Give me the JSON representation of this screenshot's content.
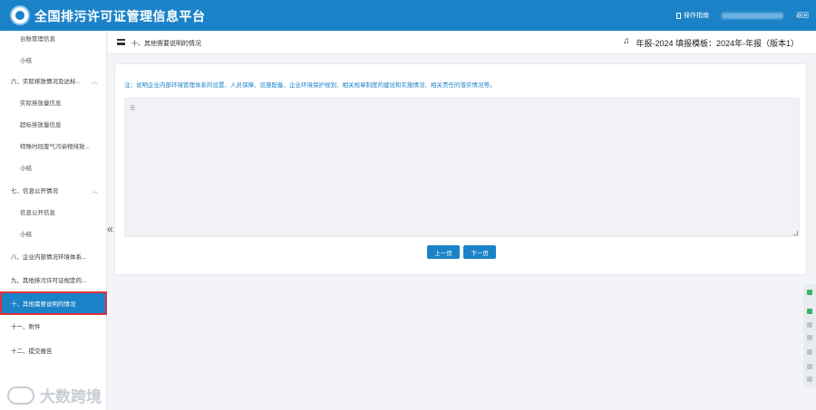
{
  "header": {
    "app_title": "全国排污许可证管理信息平台",
    "guide_label": "操作指南",
    "back_label": "返回"
  },
  "sidebar": {
    "items": [
      {
        "label": "台账管理信息"
      },
      {
        "label": "小结"
      },
      {
        "label": "六、实际排放情况及达标..."
      },
      {
        "label": "实际排放量信息"
      },
      {
        "label": "超标排放量信息"
      },
      {
        "label": "特殊时段废气污染物排放..."
      },
      {
        "label": "小结"
      },
      {
        "label": "七、信息公开情况"
      },
      {
        "label": "信息公开信息"
      },
      {
        "label": "小结"
      },
      {
        "label": "八、企业内部情况环境体系..."
      },
      {
        "label": "九、其他排污许可证规定的..."
      },
      {
        "label": "十、其他需要说明的情况"
      },
      {
        "label": "十一、附件"
      },
      {
        "label": "十二、提交报告"
      }
    ]
  },
  "page": {
    "title": "十、其他需要说明的情况",
    "meta": "年报-2024  填报模板：2024年-年报（版本1）"
  },
  "form": {
    "note": "注：说明企业内部环境管理体系的设置、人员保障、设施配备、企业环境保护规划、相关规章制度的建设和实施情况、相关责任的落实情况等。",
    "textarea_value": "无",
    "prev_label": "上一页",
    "next_label": "下一页"
  },
  "watermark": {
    "text": "大数跨境"
  }
}
